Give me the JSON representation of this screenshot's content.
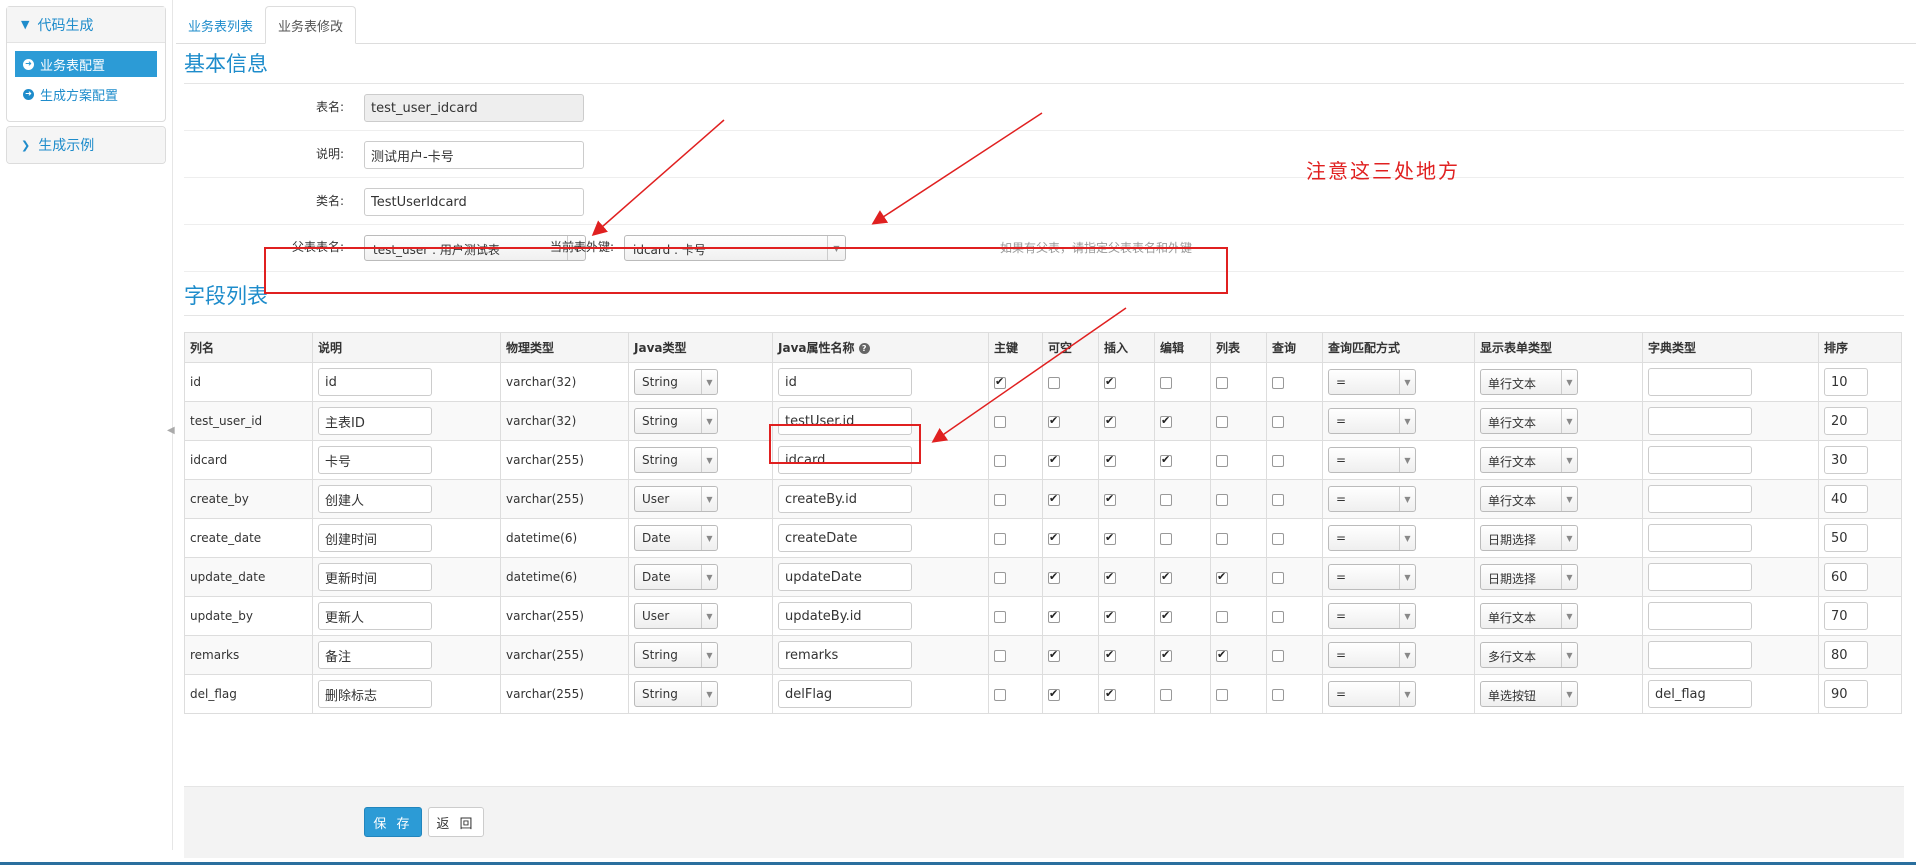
{
  "sidebar": {
    "group1_title": "代码生成",
    "items": [
      {
        "label": "业务表配置",
        "active": true
      },
      {
        "label": "生成方案配置",
        "active": false
      }
    ],
    "group2_title": "生成示例"
  },
  "tabs": [
    {
      "label": "业务表列表",
      "active": false
    },
    {
      "label": "业务表修改",
      "active": true
    }
  ],
  "basic": {
    "section_title": "基本信息",
    "table_name_label": "表名:",
    "table_name_value": "test_user_idcard",
    "comment_label": "说明:",
    "comment_value": "测试用户-卡号",
    "class_label": "类名:",
    "class_value": "TestUserIdcard",
    "parent_label": "父表表名:",
    "parent_value": "test_user : 用户测试表",
    "fk_label": "当前表外键:",
    "fk_value": "idcard : 卡号",
    "hint": "如果有父表，请指定父表表名和外键"
  },
  "annotation": {
    "note": "注意这三处地方",
    "color": "#e02020"
  },
  "fields": {
    "section_title": "字段列表",
    "headers": [
      "列名",
      "说明",
      "物理类型",
      "Java类型",
      "Java属性名称",
      "主键",
      "可空",
      "插入",
      "编辑",
      "列表",
      "查询",
      "查询匹配方式",
      "显示表单类型",
      "字典类型",
      "排序"
    ],
    "rows": [
      {
        "col": "id",
        "comment": "id",
        "jdbc": "varchar(32)",
        "java_type": "String",
        "java_field": "id",
        "pk": true,
        "nullable": false,
        "insert": true,
        "edit": false,
        "list": false,
        "query": false,
        "query_type": "=",
        "show_type": "单行文本",
        "dict": "",
        "sort": "10"
      },
      {
        "col": "test_user_id",
        "comment": "主表ID",
        "jdbc": "varchar(32)",
        "java_type": "String",
        "java_field": "testUser.id",
        "pk": false,
        "nullable": true,
        "insert": true,
        "edit": true,
        "list": false,
        "query": false,
        "query_type": "=",
        "show_type": "单行文本",
        "dict": "",
        "sort": "20"
      },
      {
        "col": "idcard",
        "comment": "卡号",
        "jdbc": "varchar(255)",
        "java_type": "String",
        "java_field": "idcard",
        "pk": false,
        "nullable": true,
        "insert": true,
        "edit": true,
        "list": false,
        "query": false,
        "query_type": "=",
        "show_type": "单行文本",
        "dict": "",
        "sort": "30"
      },
      {
        "col": "create_by",
        "comment": "创建人",
        "jdbc": "varchar(255)",
        "java_type": "User",
        "java_field": "createBy.id",
        "pk": false,
        "nullable": true,
        "insert": true,
        "edit": false,
        "list": false,
        "query": false,
        "query_type": "=",
        "show_type": "单行文本",
        "dict": "",
        "sort": "40"
      },
      {
        "col": "create_date",
        "comment": "创建时间",
        "jdbc": "datetime(6)",
        "java_type": "Date",
        "java_field": "createDate",
        "pk": false,
        "nullable": true,
        "insert": true,
        "edit": false,
        "list": false,
        "query": false,
        "query_type": "=",
        "show_type": "日期选择",
        "dict": "",
        "sort": "50"
      },
      {
        "col": "update_date",
        "comment": "更新时间",
        "jdbc": "datetime(6)",
        "java_type": "Date",
        "java_field": "updateDate",
        "pk": false,
        "nullable": true,
        "insert": true,
        "edit": true,
        "list": true,
        "query": false,
        "query_type": "=",
        "show_type": "日期选择",
        "dict": "",
        "sort": "60"
      },
      {
        "col": "update_by",
        "comment": "更新人",
        "jdbc": "varchar(255)",
        "java_type": "User",
        "java_field": "updateBy.id",
        "pk": false,
        "nullable": true,
        "insert": true,
        "edit": true,
        "list": false,
        "query": false,
        "query_type": "=",
        "show_type": "单行文本",
        "dict": "",
        "sort": "70"
      },
      {
        "col": "remarks",
        "comment": "备注",
        "jdbc": "varchar(255)",
        "java_type": "String",
        "java_field": "remarks",
        "pk": false,
        "nullable": true,
        "insert": true,
        "edit": true,
        "list": true,
        "query": false,
        "query_type": "=",
        "show_type": "多行文本",
        "dict": "",
        "sort": "80"
      },
      {
        "col": "del_flag",
        "comment": "删除标志",
        "jdbc": "varchar(255)",
        "java_type": "String",
        "java_field": "delFlag",
        "pk": false,
        "nullable": true,
        "insert": true,
        "edit": false,
        "list": false,
        "query": false,
        "query_type": "=",
        "show_type": "单选按钮",
        "dict": "del_flag",
        "sort": "90"
      }
    ]
  },
  "buttons": {
    "save": "保 存",
    "back": "返 回"
  },
  "icons": {
    "group_open": "chevron-down-icon",
    "group_closed": "chevron-right-icon",
    "menu_item": "circle-arrow-right-icon",
    "help": "question-circle-icon",
    "dropdown": "caret-down-icon"
  }
}
